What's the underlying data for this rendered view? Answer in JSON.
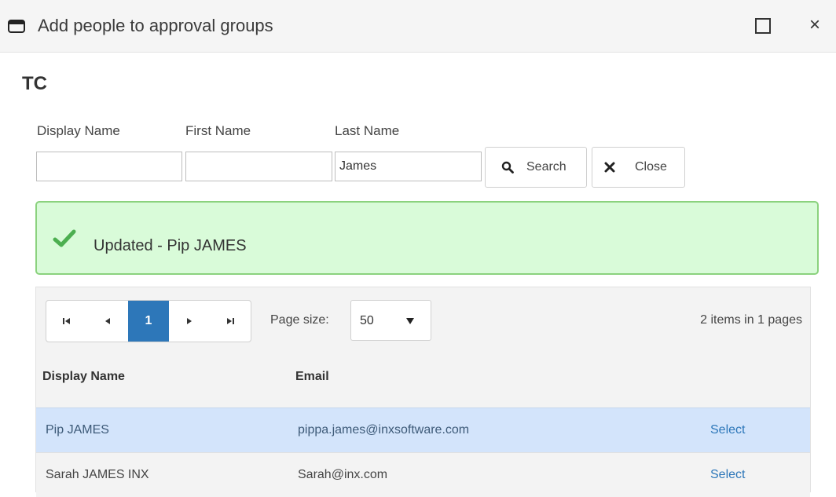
{
  "window": {
    "title": "Add people to approval groups",
    "icon": "window-icon",
    "close_symbol": "×"
  },
  "heading": "TC",
  "search": {
    "display_name": {
      "label": "Display Name",
      "value": ""
    },
    "first_name": {
      "label": "First Name",
      "value": ""
    },
    "last_name": {
      "label": "Last Name",
      "value": "James"
    },
    "search_label": "Search",
    "close_label": "Close"
  },
  "alert": {
    "text": "Updated - Pip JAMES",
    "color": "#d9fbd9",
    "icon": "checkmark-icon"
  },
  "grid": {
    "pager": {
      "current_page": "1",
      "page_size_label": "Page size:",
      "page_size": "50",
      "summary": "2 items in 1 pages"
    },
    "columns": [
      "Display Name",
      "Email"
    ],
    "rows": [
      {
        "name": "Pip JAMES",
        "email": "pippa.james@inxsoftware.com",
        "action": "Select",
        "selected": true
      },
      {
        "name": "Sarah JAMES INX",
        "email": "Sarah@inx.com",
        "action": "Select",
        "selected": false
      }
    ],
    "accent_color": "#2d77b9"
  }
}
